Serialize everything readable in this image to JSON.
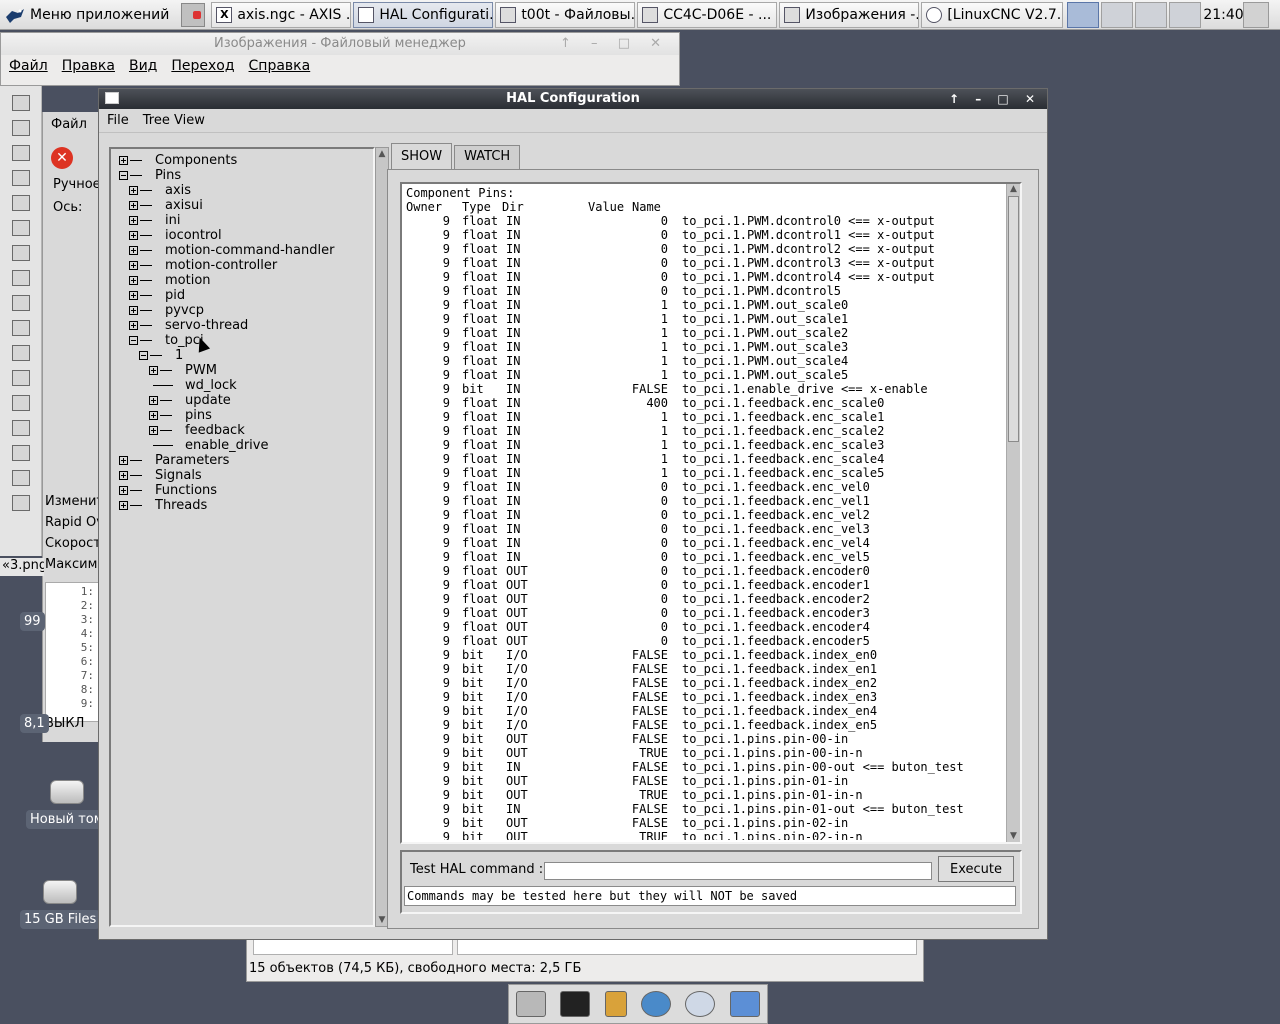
{
  "taskbar": {
    "app_menu": "Меню приложений",
    "tasks": [
      {
        "label": "axis.ngc - AXIS ...",
        "icon": "X"
      },
      {
        "label": "HAL Configurati...",
        "icon": "",
        "active": true
      },
      {
        "label": "t00t - Файловы...",
        "icon": ""
      },
      {
        "label": "CC4C-D06E - ...",
        "icon": ""
      },
      {
        "label": "Изображения -...",
        "icon": ""
      },
      {
        "label": "[LinuxCNC V2.7...",
        "icon": ""
      }
    ],
    "clock": "21:40"
  },
  "file_manager": {
    "title": "Изображения - Файловый менеджер",
    "menu": [
      "Файл",
      "Правка",
      "Вид",
      "Переход",
      "Справка"
    ],
    "status": "15 объектов (74,5 КБ), свободного места: 2,5 ГБ"
  },
  "axis_window": {
    "menu_file": "Файл",
    "manual_tab": "Ручное",
    "axis_label": "Ось:",
    "labels": [
      "Изменит",
      "Rapid Ov",
      "Скорост",
      "Максима"
    ],
    "file_tab": "«3.png",
    "line_numbers": [
      "1:",
      "2:",
      "3:",
      "4:",
      "5:",
      "6:",
      "7:",
      "8:",
      "9:"
    ],
    "off_label": "ВЫКЛ",
    "badges": [
      "99",
      "8,1"
    ]
  },
  "desktop": {
    "icons": [
      "Новый том",
      "15 GB Files"
    ]
  },
  "hal": {
    "title": "HAL Configuration",
    "menu": [
      "File",
      "Tree View"
    ],
    "tabs": [
      "SHOW",
      "WATCH"
    ],
    "tree": [
      {
        "label": "Components",
        "depth": 0,
        "expanded": false
      },
      {
        "label": "Pins",
        "depth": 0,
        "expanded": true
      },
      {
        "label": "axis",
        "depth": 1,
        "expanded": false
      },
      {
        "label": "axisui",
        "depth": 1,
        "expanded": false
      },
      {
        "label": "ini",
        "depth": 1,
        "expanded": false
      },
      {
        "label": "iocontrol",
        "depth": 1,
        "expanded": false
      },
      {
        "label": "motion-command-handler",
        "depth": 1,
        "expanded": false
      },
      {
        "label": "motion-controller",
        "depth": 1,
        "expanded": false
      },
      {
        "label": "motion",
        "depth": 1,
        "expanded": false
      },
      {
        "label": "pid",
        "depth": 1,
        "expanded": false
      },
      {
        "label": "pyvcp",
        "depth": 1,
        "expanded": false
      },
      {
        "label": "servo-thread",
        "depth": 1,
        "expanded": false
      },
      {
        "label": "to_pci",
        "depth": 1,
        "expanded": true
      },
      {
        "label": "1",
        "depth": 2,
        "expanded": true
      },
      {
        "label": "PWM",
        "depth": 3,
        "expanded": false
      },
      {
        "label": "wd_lock",
        "depth": 3,
        "leaf": true
      },
      {
        "label": "update",
        "depth": 3,
        "expanded": false
      },
      {
        "label": "pins",
        "depth": 3,
        "expanded": false
      },
      {
        "label": "feedback",
        "depth": 3,
        "expanded": false
      },
      {
        "label": "enable_drive",
        "depth": 3,
        "leaf": true
      },
      {
        "label": "Parameters",
        "depth": 0,
        "expanded": false
      },
      {
        "label": "Signals",
        "depth": 0,
        "expanded": false
      },
      {
        "label": "Functions",
        "depth": 0,
        "expanded": false
      },
      {
        "label": "Threads",
        "depth": 0,
        "expanded": false
      }
    ],
    "output_header": "Component Pins:",
    "columns": [
      "Owner",
      "Type",
      "Dir",
      "Value",
      "Name"
    ],
    "pins": [
      [
        "9",
        "float",
        "IN",
        "0",
        "to_pci.1.PWM.dcontrol0 <== x-output"
      ],
      [
        "9",
        "float",
        "IN",
        "0",
        "to_pci.1.PWM.dcontrol1 <== x-output"
      ],
      [
        "9",
        "float",
        "IN",
        "0",
        "to_pci.1.PWM.dcontrol2 <== x-output"
      ],
      [
        "9",
        "float",
        "IN",
        "0",
        "to_pci.1.PWM.dcontrol3 <== x-output"
      ],
      [
        "9",
        "float",
        "IN",
        "0",
        "to_pci.1.PWM.dcontrol4 <== x-output"
      ],
      [
        "9",
        "float",
        "IN",
        "0",
        "to_pci.1.PWM.dcontrol5"
      ],
      [
        "9",
        "float",
        "IN",
        "1",
        "to_pci.1.PWM.out_scale0"
      ],
      [
        "9",
        "float",
        "IN",
        "1",
        "to_pci.1.PWM.out_scale1"
      ],
      [
        "9",
        "float",
        "IN",
        "1",
        "to_pci.1.PWM.out_scale2"
      ],
      [
        "9",
        "float",
        "IN",
        "1",
        "to_pci.1.PWM.out_scale3"
      ],
      [
        "9",
        "float",
        "IN",
        "1",
        "to_pci.1.PWM.out_scale4"
      ],
      [
        "9",
        "float",
        "IN",
        "1",
        "to_pci.1.PWM.out_scale5"
      ],
      [
        "9",
        "bit",
        "IN",
        "FALSE",
        "to_pci.1.enable_drive <== x-enable"
      ],
      [
        "9",
        "float",
        "IN",
        "400",
        "to_pci.1.feedback.enc_scale0"
      ],
      [
        "9",
        "float",
        "IN",
        "1",
        "to_pci.1.feedback.enc_scale1"
      ],
      [
        "9",
        "float",
        "IN",
        "1",
        "to_pci.1.feedback.enc_scale2"
      ],
      [
        "9",
        "float",
        "IN",
        "1",
        "to_pci.1.feedback.enc_scale3"
      ],
      [
        "9",
        "float",
        "IN",
        "1",
        "to_pci.1.feedback.enc_scale4"
      ],
      [
        "9",
        "float",
        "IN",
        "1",
        "to_pci.1.feedback.enc_scale5"
      ],
      [
        "9",
        "float",
        "IN",
        "0",
        "to_pci.1.feedback.enc_vel0"
      ],
      [
        "9",
        "float",
        "IN",
        "0",
        "to_pci.1.feedback.enc_vel1"
      ],
      [
        "9",
        "float",
        "IN",
        "0",
        "to_pci.1.feedback.enc_vel2"
      ],
      [
        "9",
        "float",
        "IN",
        "0",
        "to_pci.1.feedback.enc_vel3"
      ],
      [
        "9",
        "float",
        "IN",
        "0",
        "to_pci.1.feedback.enc_vel4"
      ],
      [
        "9",
        "float",
        "IN",
        "0",
        "to_pci.1.feedback.enc_vel5"
      ],
      [
        "9",
        "float",
        "OUT",
        "0",
        "to_pci.1.feedback.encoder0"
      ],
      [
        "9",
        "float",
        "OUT",
        "0",
        "to_pci.1.feedback.encoder1"
      ],
      [
        "9",
        "float",
        "OUT",
        "0",
        "to_pci.1.feedback.encoder2"
      ],
      [
        "9",
        "float",
        "OUT",
        "0",
        "to_pci.1.feedback.encoder3"
      ],
      [
        "9",
        "float",
        "OUT",
        "0",
        "to_pci.1.feedback.encoder4"
      ],
      [
        "9",
        "float",
        "OUT",
        "0",
        "to_pci.1.feedback.encoder5"
      ],
      [
        "9",
        "bit",
        "I/O",
        "FALSE",
        "to_pci.1.feedback.index_en0"
      ],
      [
        "9",
        "bit",
        "I/O",
        "FALSE",
        "to_pci.1.feedback.index_en1"
      ],
      [
        "9",
        "bit",
        "I/O",
        "FALSE",
        "to_pci.1.feedback.index_en2"
      ],
      [
        "9",
        "bit",
        "I/O",
        "FALSE",
        "to_pci.1.feedback.index_en3"
      ],
      [
        "9",
        "bit",
        "I/O",
        "FALSE",
        "to_pci.1.feedback.index_en4"
      ],
      [
        "9",
        "bit",
        "I/O",
        "FALSE",
        "to_pci.1.feedback.index_en5"
      ],
      [
        "9",
        "bit",
        "OUT",
        "FALSE",
        "to_pci.1.pins.pin-00-in"
      ],
      [
        "9",
        "bit",
        "OUT",
        "TRUE",
        "to_pci.1.pins.pin-00-in-n"
      ],
      [
        "9",
        "bit",
        "IN",
        "FALSE",
        "to_pci.1.pins.pin-00-out <== buton_test"
      ],
      [
        "9",
        "bit",
        "OUT",
        "FALSE",
        "to_pci.1.pins.pin-01-in"
      ],
      [
        "9",
        "bit",
        "OUT",
        "TRUE",
        "to_pci.1.pins.pin-01-in-n"
      ],
      [
        "9",
        "bit",
        "IN",
        "FALSE",
        "to_pci.1.pins.pin-01-out <== buton_test"
      ],
      [
        "9",
        "bit",
        "OUT",
        "FALSE",
        "to_pci.1.pins.pin-02-in"
      ],
      [
        "9",
        "bit",
        "OUT",
        "TRUE",
        "to_pci.1.pins.pin-02-in-n"
      ]
    ],
    "command_label": "Test HAL command :",
    "command_value": "",
    "execute_label": "Execute",
    "command_message": "Commands may be tested here but they will NOT be saved"
  }
}
